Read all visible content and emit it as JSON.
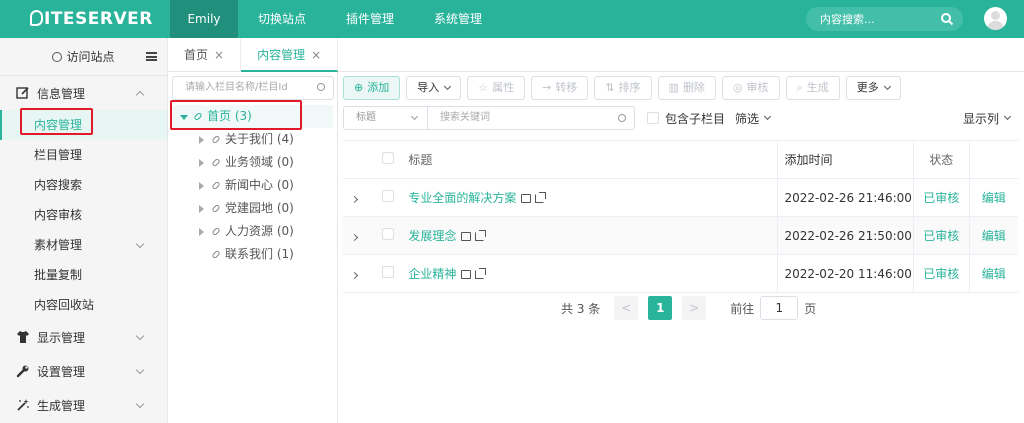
{
  "header": {
    "logo": "ITESERVER",
    "logo_mark": "S",
    "nav": [
      "Emily",
      "切换站点",
      "插件管理",
      "系统管理"
    ],
    "search_placeholder": "内容搜索..."
  },
  "sidebar": {
    "visit_label": "访问站点",
    "groups": [
      {
        "label": "信息管理",
        "icon": "edit-icon",
        "expanded": true,
        "items": [
          "内容管理",
          "栏目管理",
          "内容搜索",
          "内容审核",
          "素材管理",
          "批量复制",
          "内容回收站"
        ]
      },
      {
        "label": "显示管理",
        "icon": "shirt-icon"
      },
      {
        "label": "设置管理",
        "icon": "wrench-icon"
      },
      {
        "label": "生成管理",
        "icon": "magic-wand-icon"
      }
    ]
  },
  "tabs": [
    {
      "label": "首页",
      "close": "×"
    },
    {
      "label": "内容管理",
      "close": "×"
    }
  ],
  "tree": {
    "search_placeholder": "请输入栏目名称/栏目Id",
    "root": "首页 (3)",
    "children": [
      "关于我们 (4)",
      "业务领域 (0)",
      "新闻中心 (0)",
      "党建园地 (0)",
      "人力资源 (0)",
      "联系我们 (1)"
    ]
  },
  "toolbar": {
    "add": "添加",
    "import": "导入",
    "attrs": "属性",
    "transfer": "转移",
    "sort": "排序",
    "delete": "删除",
    "audit": "审核",
    "generate": "生成",
    "more": "更多"
  },
  "filter": {
    "field_select": "标题",
    "keyword_placeholder": "搜索关键词",
    "include_children": "包含子栏目",
    "screen": "筛选",
    "show_columns": "显示列"
  },
  "table": {
    "headers": {
      "title": "标题",
      "time": "添加时间",
      "status": "状态"
    },
    "rows": [
      {
        "title": "专业全面的解决方案",
        "time": "2022-02-26 21:46:00",
        "status": "已审核",
        "action": "编辑"
      },
      {
        "title": "发展理念",
        "time": "2022-02-26 21:50:00",
        "status": "已审核",
        "action": "编辑"
      },
      {
        "title": "企业精神",
        "time": "2022-02-20 11:46:00",
        "status": "已审核",
        "action": "编辑"
      }
    ]
  },
  "pager": {
    "total": "共 3 条",
    "prev": "<",
    "current": "1",
    "next": ">",
    "goto": "前往",
    "page_value": "1",
    "page_unit": "页"
  },
  "colors": {
    "primary": "#29b39b",
    "highlight_box": "#e0192b"
  }
}
